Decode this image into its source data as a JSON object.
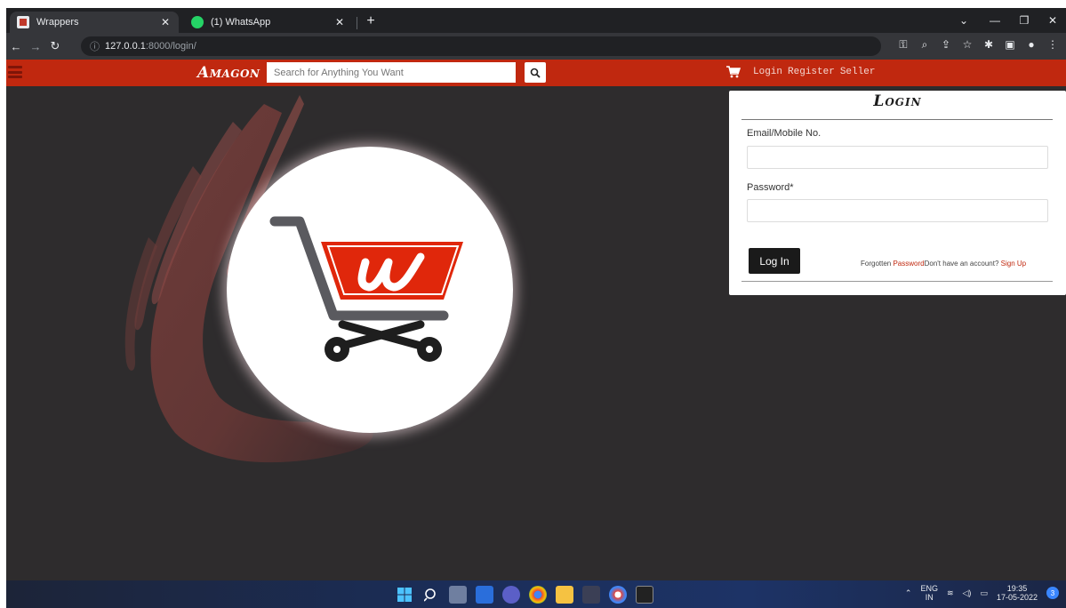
{
  "browser": {
    "tabs": [
      {
        "title": "Wrappers",
        "active": true
      },
      {
        "title": "(1) WhatsApp",
        "active": false
      }
    ],
    "new_tab_label": "+",
    "url_host": "127.0.0.1",
    "url_path": ":8000/login/"
  },
  "site": {
    "logo": "Amagon",
    "search_placeholder": "Search for Anything You Want",
    "nav_links": [
      "Login",
      "Register",
      "Seller"
    ],
    "brand_color": "#c0280f"
  },
  "login": {
    "title": "Login",
    "email_label": "Email/Mobile No.",
    "password_label": "Password*",
    "submit_label": "Log In",
    "forgot_prefix": "Forgotten ",
    "forgot_link": "Password",
    "signup_prefix": "Don't have an account?  ",
    "signup_link": "Sign Up"
  },
  "taskbar": {
    "lang_top": "ENG",
    "lang_bottom": "IN",
    "time": "19:35",
    "date": "17-05-2022",
    "notification_count": "3"
  }
}
